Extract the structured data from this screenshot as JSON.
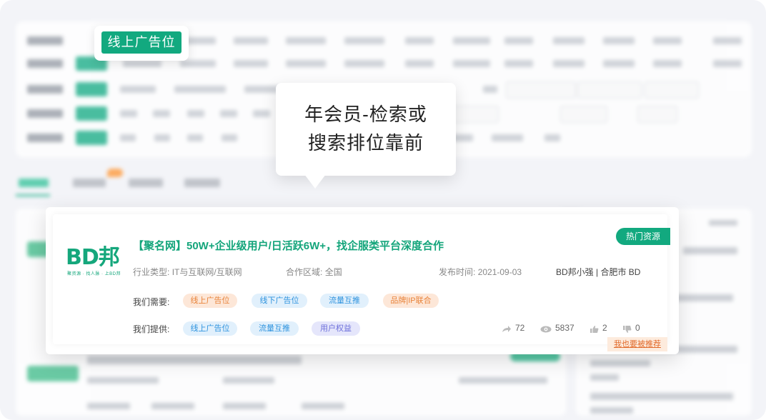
{
  "highlight": {
    "label": "线上广告位"
  },
  "tooltip": {
    "line1": "年会员-检索或",
    "line2": "搜索排位靠前"
  },
  "card": {
    "hot_tag": "热门资源",
    "logo_text": "BD邦",
    "logo_sub": "聚资源 · 找人脉 · 上BD邦",
    "title": "【聚名网】50W+企业级用户/日活跃6W+，找企服类平台深度合作",
    "industry_label": "行业类型:",
    "industry_value": "IT与互联网/互联网",
    "region_label": "合作区域:",
    "region_value": "全国",
    "date_label": "发布时间:",
    "date_value": "2021-09-03",
    "author": "BD邦小强 | 合肥市 BD",
    "need_label": "我们需要:",
    "needs": [
      "线上广告位",
      "线下广告位",
      "流量互推",
      "品牌|IP联合"
    ],
    "offer_label": "我们提供:",
    "offers": [
      "线上广告位",
      "流量互推",
      "用户权益"
    ],
    "stats": {
      "shares": "72",
      "views": "5837",
      "likes": "2",
      "dislikes": "0"
    },
    "recommend_link": "我也要被推荐"
  },
  "colors": {
    "brand": "#12a97f",
    "orange_tag": "#e8833a",
    "blue_tag": "#2f93de",
    "purple_tag": "#6c6fdb"
  },
  "icons": [
    "share-icon",
    "eye-icon",
    "thumbs-up-icon",
    "thumbs-down-icon"
  ]
}
